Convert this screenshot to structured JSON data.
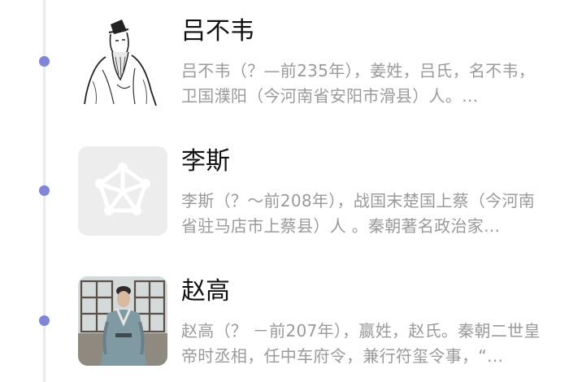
{
  "colors": {
    "timeline_line": "#e8e8f6",
    "timeline_dot": "#7f86d8",
    "title_text": "#111111",
    "description_text": "#9a9a9a",
    "placeholder_bg": "#ededed",
    "placeholder_icon": "#ffffff"
  },
  "entries": [
    {
      "name": "吕不韦",
      "description": "吕不韦（？—前235年），姜姓，吕氏，名不韦，卫国濮阳（今河南省安阳市滑县）人。…",
      "image": "portrait-line-drawing"
    },
    {
      "name": "李斯",
      "description": "李斯（？～前208年），战国末楚国上蔡（今河南省驻马店市上蔡县）人 。秦朝著名政治家…",
      "image": "placeholder-star-icon"
    },
    {
      "name": "赵高",
      "description": "赵高（？ －前207年），嬴姓，赵氏。秦朝二世皇帝时丞相，任中车府令，兼行符玺令事，“…",
      "image": "photo-costumed-figure"
    }
  ]
}
